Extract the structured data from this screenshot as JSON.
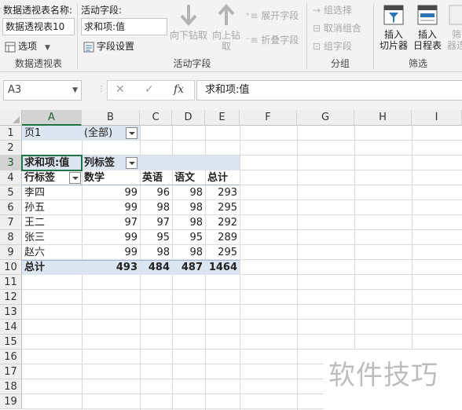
{
  "ribbon": {
    "pivot_name_label": "数据透视表名称:",
    "pivot_name_value": "数据透视表10",
    "options_label": "选项",
    "group1_label": "数据透视表",
    "active_field_label": "活动字段:",
    "active_field_value": "求和项:值",
    "field_settings_label": "字段设置",
    "drill_down_label": "向下钻取",
    "drill_up_label_1": "向上钻",
    "drill_up_label_2": "取",
    "expand_field_label": "展开字段",
    "collapse_field_label": "折叠字段",
    "group2_label": "活动字段",
    "group_selection_label": "组选择",
    "ungroup_label": "取消组合",
    "group_field_label": "组字段",
    "group3_label": "分组",
    "insert_slicer_label_1": "插入",
    "insert_slicer_label_2": "切片器",
    "insert_timeline_label_1": "插入",
    "insert_timeline_label_2": "日程表",
    "filter_conn_label_1": "筛",
    "filter_conn_label_2": "器连",
    "group4_label": "筛选"
  },
  "formula_bar": {
    "name_box": "A3",
    "cancel_icon": "✕",
    "enter_icon": "✓",
    "fx_label": "fx",
    "content": "求和项:值"
  },
  "sheet": {
    "columns": [
      "A",
      "B",
      "C",
      "D",
      "E",
      "F",
      "G",
      "H",
      "I"
    ],
    "rows": [
      "1",
      "2",
      "3",
      "4",
      "5",
      "6",
      "7",
      "8",
      "9",
      "10",
      "11",
      "12",
      "13",
      "14",
      "15",
      "16",
      "17",
      "18",
      "19"
    ],
    "filter_label": "页1",
    "filter_value": "(全部)",
    "sum_label": "求和项:值",
    "col_labels": "列标签",
    "row_labels": "行标签",
    "headers": [
      "数学",
      "英语",
      "语文",
      "总计"
    ],
    "data_rows": [
      {
        "name": "李四",
        "v": [
          "99",
          "96",
          "98",
          "293"
        ]
      },
      {
        "name": "孙五",
        "v": [
          "99",
          "98",
          "98",
          "295"
        ]
      },
      {
        "name": "王二",
        "v": [
          "97",
          "97",
          "98",
          "292"
        ]
      },
      {
        "name": "张三",
        "v": [
          "99",
          "95",
          "95",
          "289"
        ]
      },
      {
        "name": "赵六",
        "v": [
          "99",
          "98",
          "98",
          "295"
        ]
      }
    ],
    "total_label": "总计",
    "totals": [
      "493",
      "484",
      "487",
      "1464"
    ]
  },
  "watermark": "软件技巧",
  "colors": {
    "accent": "#217346",
    "pivot_band": "#dce6f1"
  }
}
